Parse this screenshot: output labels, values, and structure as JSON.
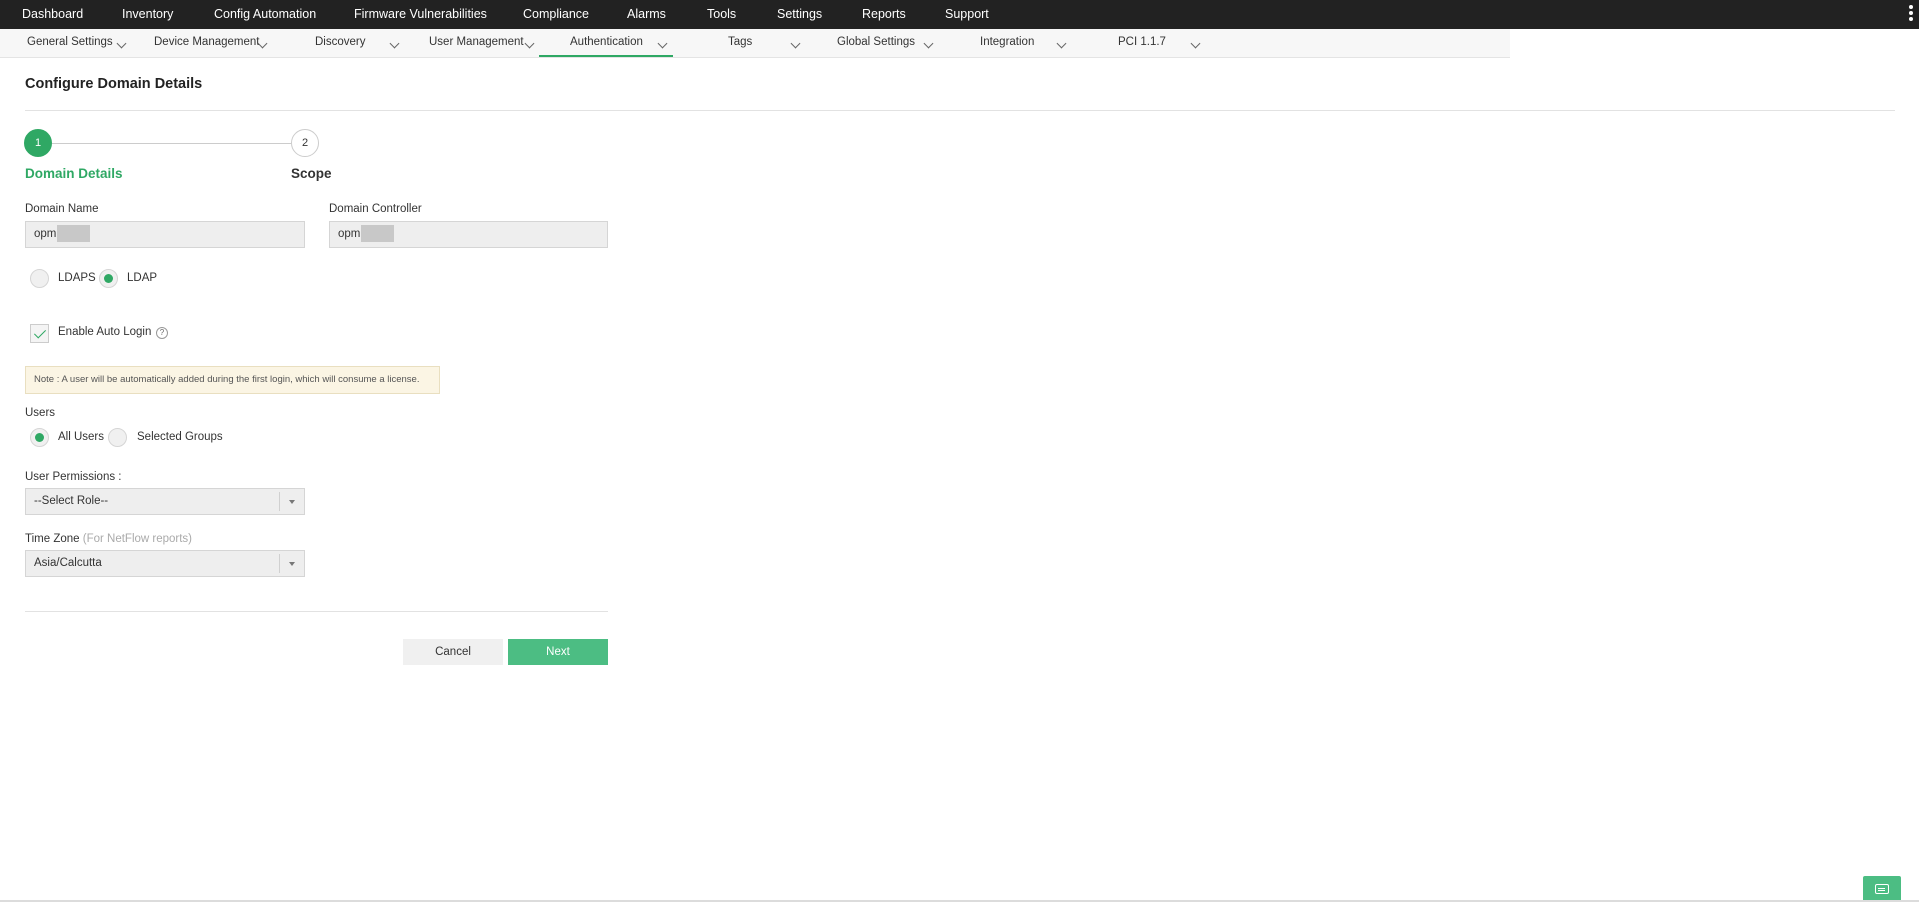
{
  "top_nav": {
    "items": [
      "Dashboard",
      "Inventory",
      "Config Automation",
      "Firmware Vulnerabilities",
      "Compliance",
      "Alarms",
      "Tools",
      "Settings",
      "Reports",
      "Support"
    ]
  },
  "sub_nav": {
    "items": [
      "General Settings",
      "Device Management",
      "Discovery",
      "User Management",
      "Authentication",
      "Tags",
      "Global Settings",
      "Integration",
      "PCI 1.1.7"
    ],
    "active": "Authentication"
  },
  "page": {
    "title": "Configure Domain Details"
  },
  "stepper": {
    "step1_number": "1",
    "step1_label": "Domain Details",
    "step2_number": "2",
    "step2_label": "Scope"
  },
  "form": {
    "domain_name_label": "Domain Name",
    "domain_name_value": "opm",
    "domain_controller_label": "Domain Controller",
    "domain_controller_value": "opm",
    "protocol_options": [
      "LDAPS",
      "LDAP"
    ],
    "protocol_selected": "LDAP",
    "auto_login_label": "Enable Auto Login",
    "auto_login_checked": true,
    "help_glyph": "?",
    "note": "Note : A user will be automatically added during the first login, which will consume a license.",
    "users_label": "Users",
    "users_options": [
      "All Users",
      "Selected Groups"
    ],
    "users_selected": "All Users",
    "user_permissions_label": "User Permissions :",
    "user_permissions_value": "--Select Role--",
    "time_zone_label": "Time Zone",
    "time_zone_hint": "(For NetFlow reports)",
    "time_zone_value": "Asia/Calcutta"
  },
  "buttons": {
    "cancel": "Cancel",
    "next": "Next"
  },
  "colors": {
    "accent": "#2fa864",
    "button_primary": "#4cbd83",
    "nav_bg": "#222222"
  },
  "icons": [
    "kebab-menu-icon",
    "chevron-down-icon",
    "help-icon",
    "dropdown-caret-icon",
    "chat-icon"
  ]
}
